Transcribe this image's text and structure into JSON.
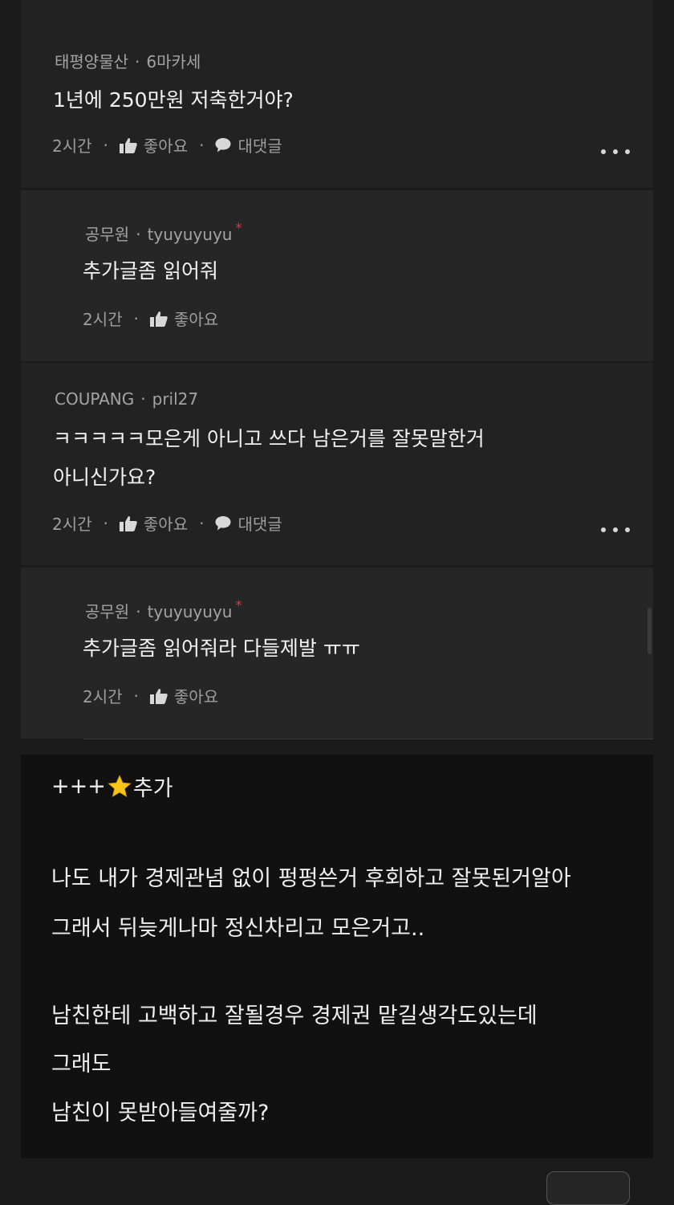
{
  "comments": [
    {
      "company": "태평양물산",
      "nickname": "6마카세",
      "text_lines": [
        "1년에 250만원 저축한거야?"
      ],
      "time": "2시간",
      "like_label": "좋아요",
      "reply_label": "대댓글"
    },
    {
      "company": "공무원",
      "nickname": "tyuyuyuyu",
      "author_mark": "*",
      "text_lines": [
        "추가글좀 읽어줘"
      ],
      "time": "2시간",
      "like_label": "좋아요"
    },
    {
      "company": "COUPANG",
      "nickname": "pril27",
      "text_lines": [
        "ㅋㅋㅋㅋㅋ모은게 아니고 쓰다 남은거를 잘못말한거",
        "아니신가요?"
      ],
      "time": "2시간",
      "like_label": "좋아요",
      "reply_label": "대댓글"
    },
    {
      "company": "공무원",
      "nickname": "tyuyuyuyu",
      "author_mark": "*",
      "text_lines": [
        "추가글좀 읽어줘라 다들제발 ㅠㅠ"
      ],
      "time": "2시간",
      "like_label": "좋아요"
    }
  ],
  "addendum": {
    "heading_prefix": "+++",
    "heading_suffix": "추가",
    "lines": [
      "나도 내가 경제관념 없이 펑펑쓴거 후회하고 잘못된거알아",
      "그래서 뒤늦게나마 정신차리고 모은거고..",
      "남친한테 고백하고 잘될경우 경제권 맡길생각도있는데",
      "그래도",
      "남친이 못받아들여줄까?"
    ]
  },
  "colors": {
    "background": "#1b1b1b",
    "card": "#222222",
    "reply_card": "#262626",
    "post_box": "#111111",
    "author_mark": "#e0393e",
    "star": "#f5c518"
  }
}
